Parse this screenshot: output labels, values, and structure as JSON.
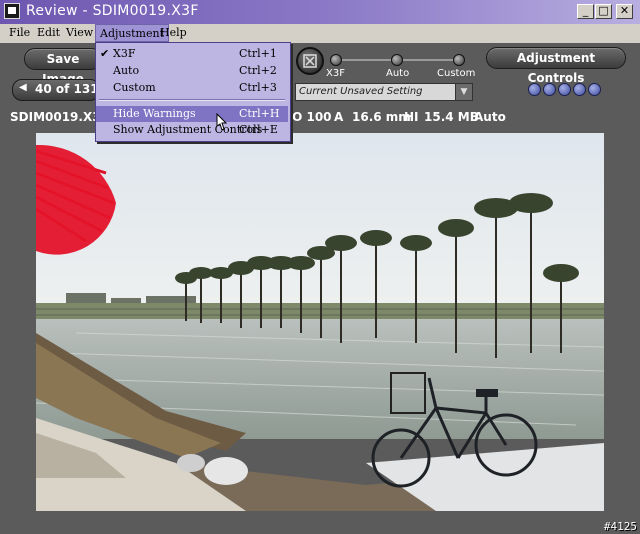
{
  "window": {
    "title": "Review - SDIM0019.X3F"
  },
  "menubar": {
    "items": [
      "File",
      "Edit",
      "View",
      "Adjustment",
      "Help"
    ]
  },
  "toolbar": {
    "save_label": "Save Image",
    "adjustment_controls_label": "Adjustment Controls",
    "nav_counter": "40 of 131",
    "slider_labels": [
      "X3F",
      "Auto",
      "Custom"
    ],
    "setting_value": "Current Unsaved Setting"
  },
  "adjustment_menu": {
    "items": [
      {
        "label": "X3F",
        "shortcut": "Ctrl+1",
        "checked": true
      },
      {
        "label": "Auto",
        "shortcut": "Ctrl+2",
        "checked": false
      },
      {
        "label": "Custom",
        "shortcut": "Ctrl+3",
        "checked": false
      },
      {
        "label": "Hide Warnings",
        "shortcut": "Ctrl+H",
        "checked": false,
        "highlighted": true
      },
      {
        "label": "Show Adjustment Controls",
        "shortcut": "Ctrl+E",
        "checked": false
      }
    ]
  },
  "infobar": {
    "filename": "SDIM0019.X3F",
    "iso": "ISO 100",
    "mode": "A",
    "focal": "16.6 mm",
    "quality": "HI",
    "size": "15.4 MB",
    "wb": "Auto"
  },
  "watermark": "#4125",
  "colors": {
    "title_start": "#6d57b0",
    "menu_bg": "#bdb5e2",
    "highlight": "#7f73c4",
    "warning_red": "#e4142a"
  }
}
